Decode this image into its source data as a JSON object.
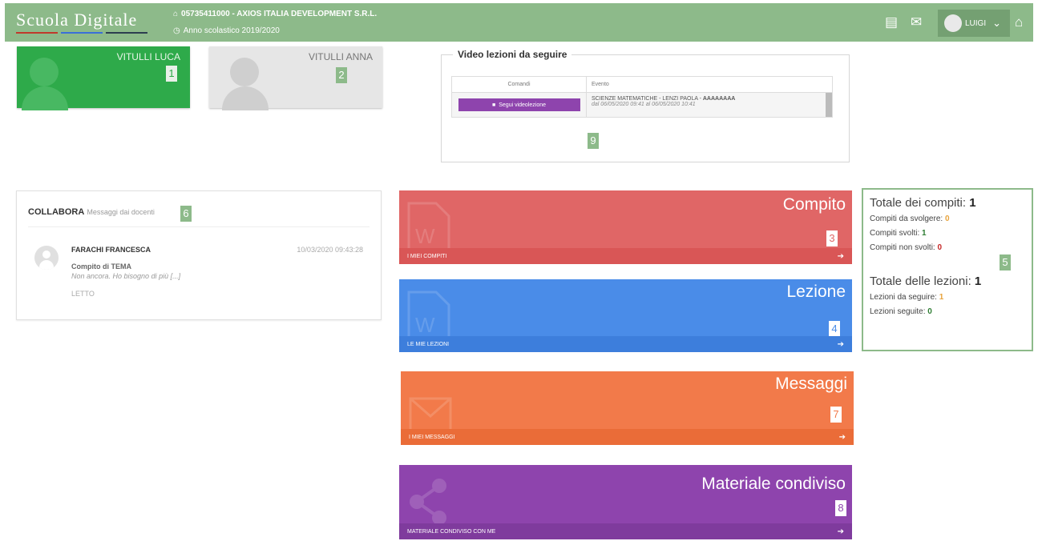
{
  "header": {
    "logo": "Scuola Digitale",
    "school_code_name": "05735411000 - AXIOS ITALIA DEVELOPMENT S.R.L.",
    "school_year": "Anno scolastico 2019/2020",
    "user_name": "LUIGI",
    "icons": [
      "building-icon",
      "mail-icon",
      "home-icon"
    ]
  },
  "students": [
    {
      "name": "VITULLI LUCA",
      "badge": "1",
      "color": "#2eaa4a"
    },
    {
      "name": "VITULLI ANNA",
      "badge": "2",
      "color": "#e6e6e6"
    }
  ],
  "video_lessons": {
    "title": "Video lezioni da seguire",
    "col_commands": "Comandi",
    "col_event": "Evento",
    "button_label": "Segui videolezione",
    "event_subject": "SCIENZE MATEMATICHE - LENZI PAOLA - ",
    "event_name": "AAAAAAAA",
    "event_dates": "dal 06/05/2020 09:41 al 06/05/2020 10:41",
    "badge": "9"
  },
  "collabora": {
    "title": "COLLABORA",
    "subtitle": "Messaggi dai docenti",
    "badge": "6",
    "message": {
      "sender": "FARACHI FRANCESCA",
      "date": "10/03/2020 09:43:28",
      "subject": "Compito di TEMA",
      "preview": "Non ancora. Ho bisogno di più  [...]",
      "status": "LETTO"
    }
  },
  "tiles": [
    {
      "title": "Compito",
      "footer": "I MIEI COMPITI",
      "badge": "3",
      "color": "#e06666",
      "footer_color": "#d95656"
    },
    {
      "title": "Lezione",
      "footer": "LE MIE LEZIONI",
      "badge": "4",
      "color": "#4a8ce8",
      "footer_color": "#3d7edc"
    },
    {
      "title": "Messaggi",
      "footer": "I MIEI MESSAGGI",
      "badge": "7",
      "color": "#f27a4a",
      "footer_color": "#ea6c38"
    },
    {
      "title": "Materiale condiviso",
      "footer": "MATERIALE CONDIVISO CON ME",
      "badge": "8",
      "color": "#8e44ad",
      "footer_color": "#7f3b9d"
    }
  ],
  "stats": {
    "tasks_total_label": "Totale dei compiti:",
    "tasks_total": "1",
    "tasks_todo_label": "Compiti da svolgere:",
    "tasks_todo": "0",
    "tasks_done_label": "Compiti svolti:",
    "tasks_done": "1",
    "tasks_notdone_label": "Compiti non svolti:",
    "tasks_notdone": "0",
    "lessons_total_label": "Totale delle lezioni:",
    "lessons_total": "1",
    "lessons_todo_label": "Lezioni da seguire:",
    "lessons_todo": "1",
    "lessons_done_label": "Lezioni seguite:",
    "lessons_done": "0",
    "badge": "5"
  }
}
